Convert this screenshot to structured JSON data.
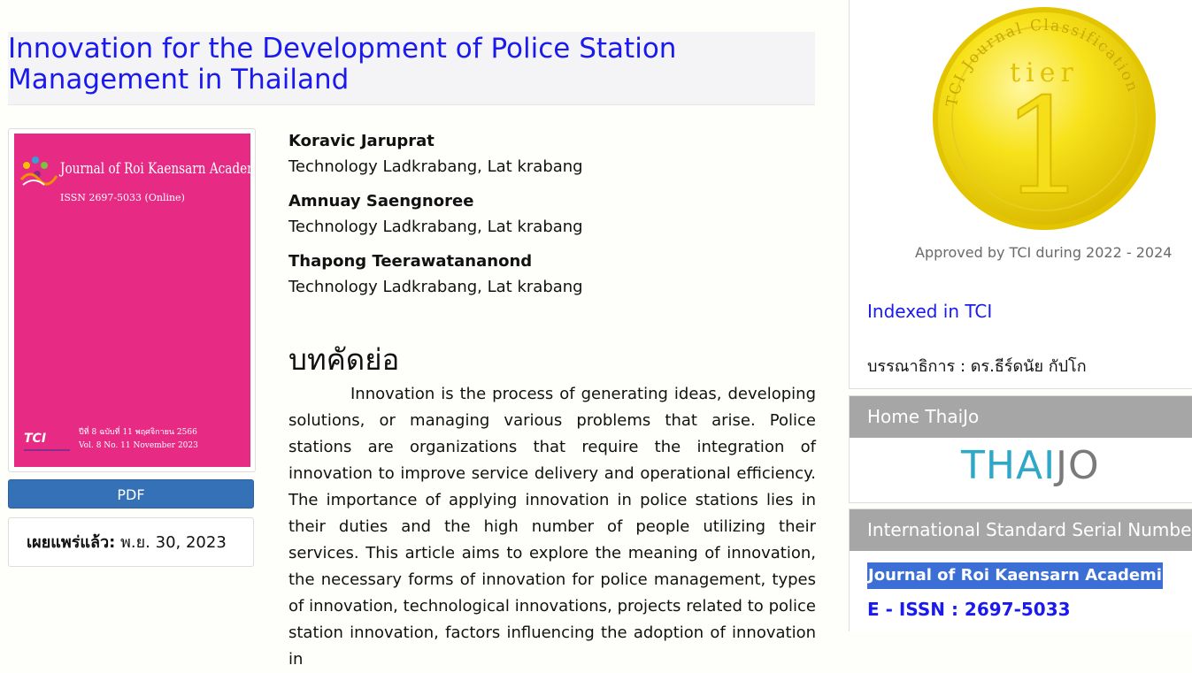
{
  "article": {
    "title": "Innovation for the Development of Police Station Management in Thailand",
    "pdf_label": "PDF",
    "published_label": "เผยแพร่แล้ว:",
    "published_date": " พ.ย. 30, 2023",
    "authors": [
      {
        "name": "Koravic Jaruprat",
        "affiliation": "Technology Ladkrabang, Lat krabang"
      },
      {
        "name": "Amnuay Saengnoree",
        "affiliation": "Technology Ladkrabang, Lat krabang"
      },
      {
        "name": "Thapong Teerawatananond",
        "affiliation": "Technology Ladkrabang, Lat krabang"
      }
    ],
    "abstract_heading": "บทคัดย่อ",
    "abstract_text": "Innovation is the process of generating ideas, developing solutions, or managing various problems that arise. Police stations are organizations that require the integration of innovation to improve service delivery and operational efficiency. The importance of applying innovation in police stations lies in their duties and the high number of people utilizing their services. This article aims to explore the meaning of innovation, the necessary forms of innovation for police management, types of innovation, technological innovations, projects related to police station innovation, factors influencing the adoption of innovation in"
  },
  "cover": {
    "journal_title": "Journal of Roi Kaensarn Academi",
    "issn": "ISSN 2697-5033 (Online)",
    "thai_issue": "ปีที่ 8 ฉบับที่ 11 พฤศจิกายน 2566",
    "vol_issue": "Vol. 8 No. 11 November 2023",
    "publisher_mark": "TCI",
    "bg_color": "#e72a84"
  },
  "sidebar": {
    "coin_ring_text": "TCI Journal Classification",
    "coin_tier": "tier",
    "coin_number": "1",
    "approved": "Approved by TCI during 2022 - 2024",
    "indexed": "Indexed in TCI",
    "editor": "บรรณาธิการ : ดร.ธีร์ดนัย กัปโก",
    "home_thaijo_header": "Home ThaiJo",
    "thaijo_logo_a": "THAI",
    "thaijo_logo_b": "JO",
    "issn_header": "International Standard Serial Number",
    "issn_journal_name": "Journal of Roi Kaensarn Academi",
    "issn_number": "E - ISSN : 2697-5033"
  },
  "colors": {
    "title_blue": "#1a1aee",
    "pdf_button": "#3571b7",
    "block_header": "#a6a6a6"
  }
}
